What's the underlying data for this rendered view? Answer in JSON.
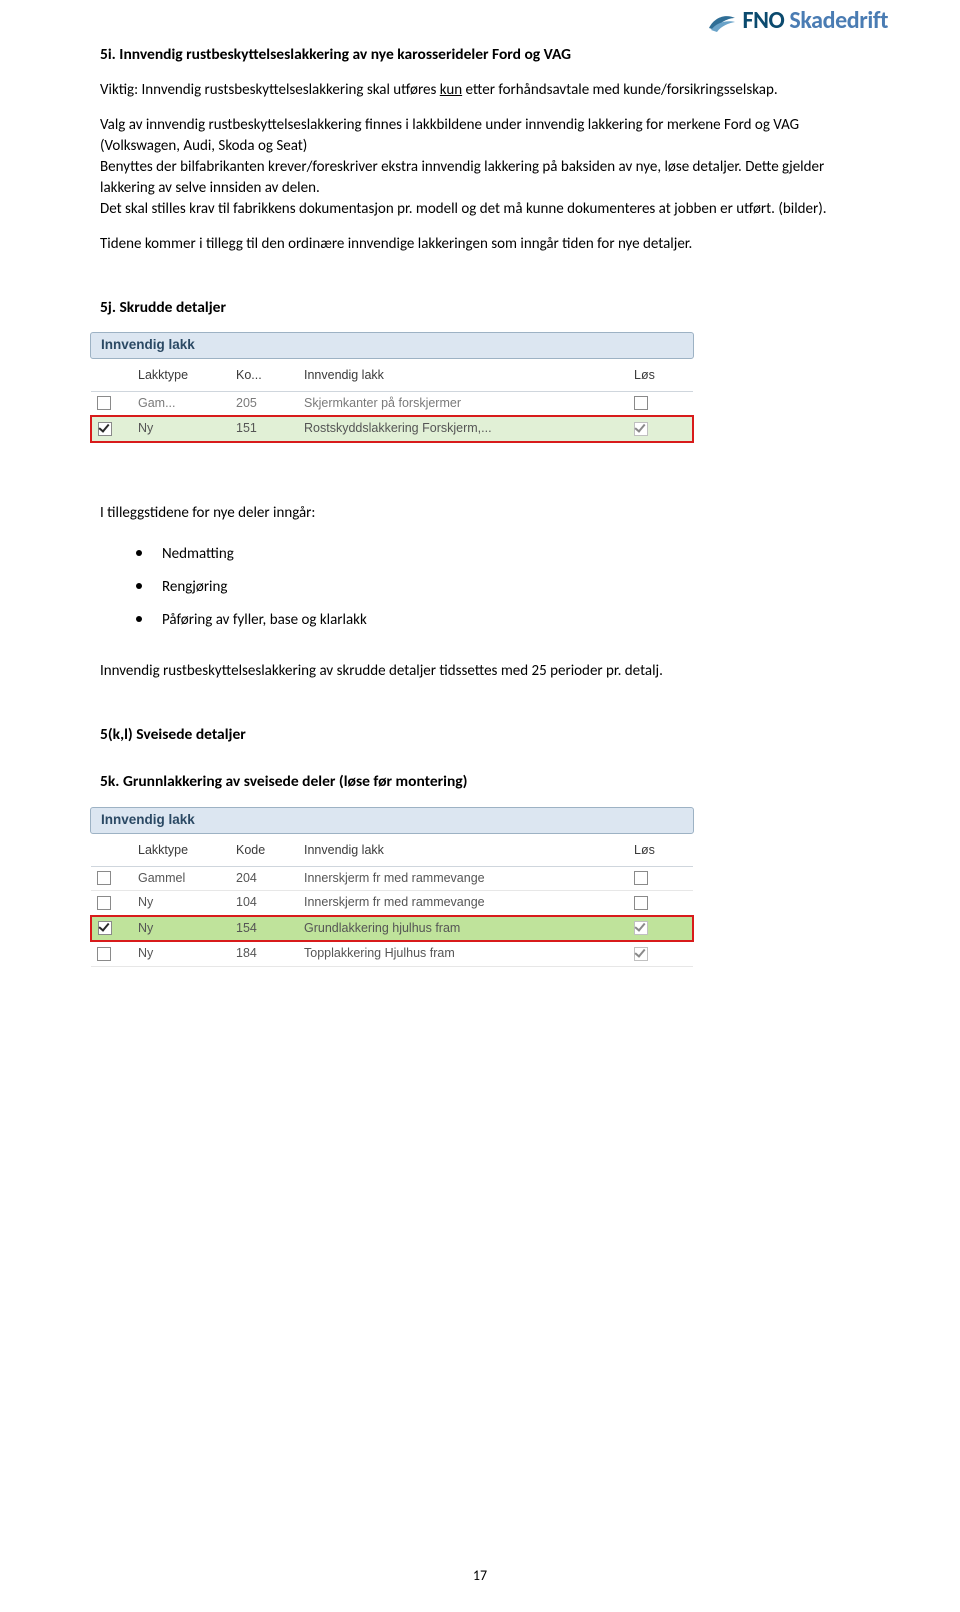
{
  "logo": {
    "brand": "FNO",
    "sub": " Skadedrift"
  },
  "section5i": {
    "title": "5i. Innvendig rustbeskyttelseslakkering av nye karosserideler Ford og VAG",
    "p1_lead": "Viktig: Innvendig rustsbeskyttelseslakkering skal utføres ",
    "p1_u": "kun",
    "p1_tail": " etter forhåndsavtale med kunde/forsikringsselskap.",
    "p2": "Valg av innvendig rustbeskyttelseslakkering finnes i lakkbildene under innvendig lakkering for merkene Ford og VAG (Volkswagen, Audi, Skoda og Seat)",
    "p2b": "Benyttes der bilfabrikanten krever/foreskriver ekstra innvendig lakkering på baksiden av nye, løse detaljer. Dette gjelder lakkering av selve innsiden av delen.",
    "p2c": "Det skal stilles krav til fabrikkens dokumentasjon pr. modell og det må kunne dokumenteres at jobben er utført. (bilder).",
    "p3": "Tidene kommer i tillegg til den ordinære innvendige lakkeringen som inngår tiden for nye detaljer."
  },
  "section5j": {
    "title": "5j. Skrudde detaljer",
    "table": {
      "caption": "Innvendig lakk",
      "cols": [
        "",
        "Lakktype",
        "Ko...",
        "Innvendig lakk",
        "Løs"
      ],
      "rows": [
        {
          "chk": false,
          "type": "Gam...",
          "code": "205",
          "desc": "Skjermkanter på forskjermer",
          "los": false,
          "cls": "muted"
        },
        {
          "chk": true,
          "type": "Ny",
          "code": "151",
          "desc": "Rostskyddslakkering Forskjerm,...",
          "los": true,
          "cls": "hl-red",
          "losDim": true
        }
      ]
    },
    "list_intro": "I tilleggstidene for nye deler inngår:",
    "bullets": [
      "Nedmatting",
      "Rengjøring",
      "Påføring av fyller, base og klarlakk"
    ],
    "p_after": "Innvendig rustbeskyttelseslakkering av skrudde detaljer tidssettes med 25 perioder pr. detalj."
  },
  "section5kl": {
    "title": "5(k,l) Sveisede detaljer",
    "sub5k": "5k. Grunnlakkering av sveisede deler (løse før montering)",
    "table": {
      "caption": "Innvendig lakk",
      "cols": [
        "",
        "Lakktype",
        "Kode",
        "Innvendig lakk",
        "Løs"
      ],
      "rows": [
        {
          "chk": false,
          "type": "Gammel",
          "code": "204",
          "desc": "Innerskjerm fr med rammevange",
          "los": false
        },
        {
          "chk": false,
          "type": "Ny",
          "code": "104",
          "desc": "Innerskjerm fr med rammevange",
          "los": false
        },
        {
          "chk": true,
          "type": "Ny",
          "code": "154",
          "desc": "Grundlakkering hjulhus fram",
          "los": true,
          "losDim": true,
          "cls": "hl-grn"
        },
        {
          "chk": false,
          "type": "Ny",
          "code": "184",
          "desc": "Topplakkering Hjulhus fram",
          "los": true,
          "losDim": true
        }
      ]
    }
  },
  "page_number": "17"
}
